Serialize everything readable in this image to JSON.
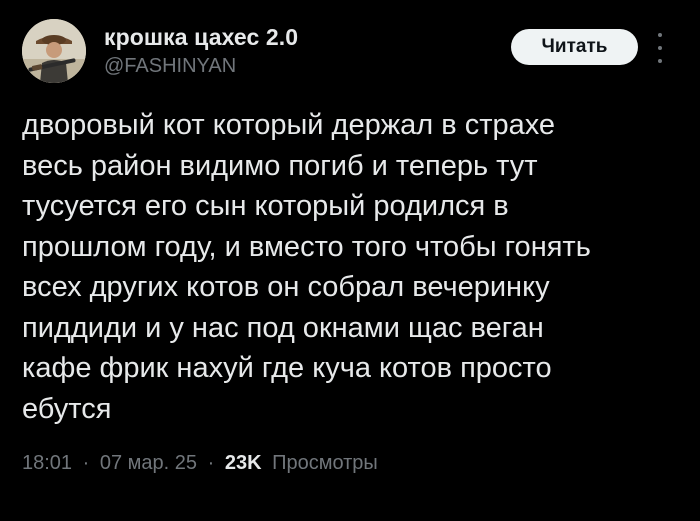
{
  "author": {
    "display_name": "крошка цахес 2.0",
    "handle": "@FASHINYAN",
    "avatar_icon": "avatar-image"
  },
  "actions": {
    "follow_label": "Читать",
    "more_icon": "more-dots-icon"
  },
  "tweet": {
    "text": "дворовый кот который держал в страхе\nвесь район видимо погиб и теперь тут\nтусуется его сын который родился в\nпрошлом году, и вместо того чтобы гонять\nвсех других котов он собрал вечеринку\nпиддиди и у нас под окнами щас веган\nкафе фрик нахуй где куча котов просто\nебутся"
  },
  "meta": {
    "time": "18:01",
    "separator": "·",
    "date": "07 мар. 25",
    "views_count": "23K",
    "views_label": "Просмотры"
  },
  "colors": {
    "background": "#000000",
    "primary_text": "#e7e9ea",
    "secondary_text": "#71767b",
    "button_bg": "#eff3f4"
  }
}
